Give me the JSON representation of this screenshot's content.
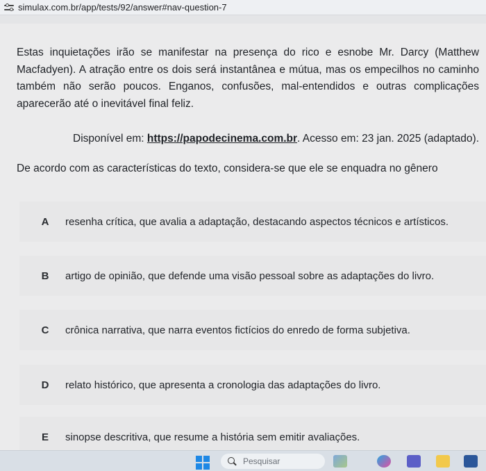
{
  "browser": {
    "url": "simulax.com.br/app/tests/92/answer#nav-question-7"
  },
  "passage": {
    "text": "Estas inquietações irão se manifestar na presença do rico e esnobe Mr. Darcy (Matthew Macfadyen). A atração entre os dois será instantânea e mútua, mas os empecilhos no caminho também não serão poucos. Enganos, confusões, mal-entendidos e outras complicações aparecerão até o inevitável final feliz."
  },
  "source": {
    "prefix": "Disponível em: ",
    "link": "https://papodecinema.com.br",
    "suffix": ". Acesso em: 23 jan. 2025 (adaptado)."
  },
  "question": {
    "text": "De acordo com as características do texto, considera-se que ele se enquadra no gênero"
  },
  "options": [
    {
      "letter": "A",
      "text": "resenha crítica, que avalia a adaptação, destacando aspectos técnicos e artísticos."
    },
    {
      "letter": "B",
      "text": "artigo de opinião, que defende uma visão pessoal sobre as adaptações do livro."
    },
    {
      "letter": "C",
      "text": "crônica narrativa, que narra eventos fictícios do enredo de forma subjetiva."
    },
    {
      "letter": "D",
      "text": "relato histórico, que apresenta a cronologia das adaptações do livro."
    },
    {
      "letter": "E",
      "text": "sinopse descritiva, que resume a história sem emitir avaliações."
    }
  ],
  "taskbar": {
    "search_placeholder": "Pesquisar",
    "apps": [
      "windows-start-icon",
      "search-icon",
      "landscape-widget-icon",
      "copilot-icon",
      "teams-icon",
      "file-explorer-icon",
      "word-icon"
    ],
    "colors": {
      "start": "#1e88e5",
      "word": "#2b579a",
      "teams": "#5b5fc7",
      "explorer": "#f2c94c"
    }
  }
}
